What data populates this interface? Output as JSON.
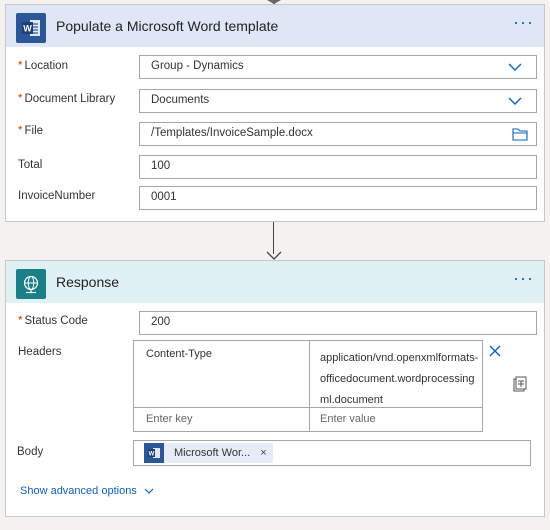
{
  "word_card": {
    "title": "Populate a Microsoft Word template",
    "more_label": "···",
    "accent": "#2b5797",
    "header_bg": "#dfe6f5",
    "fields": [
      {
        "label": "Location",
        "required": true,
        "value": "Group - Dynamics",
        "control": "dropdown"
      },
      {
        "label": "Document Library",
        "required": true,
        "value": "Documents",
        "control": "dropdown"
      },
      {
        "label": "File",
        "required": true,
        "value": "/Templates/InvoiceSample.docx",
        "control": "file-picker"
      },
      {
        "label": "Total",
        "required": false,
        "value": "100",
        "control": "text"
      },
      {
        "label": "InvoiceNumber",
        "required": false,
        "value": "0001",
        "control": "text"
      }
    ]
  },
  "response_card": {
    "title": "Response",
    "more_label": "···",
    "accent": "#1a7f86",
    "header_bg": "#dff1f3",
    "status_code": {
      "label": "Status Code",
      "required": true,
      "value": "200"
    },
    "headers": {
      "label": "Headers",
      "rows": [
        {
          "key": "Content-Type",
          "value": "application/vnd.openxmlformats-officedocument.wordprocessingml.document"
        }
      ],
      "key_placeholder": "Enter key",
      "value_placeholder": "Enter value"
    },
    "body": {
      "label": "Body",
      "token_label": "Microsoft Wor...",
      "token_remove": "×"
    },
    "advanced_options": "Show advanced options"
  },
  "required_marker": "*",
  "link_color": "#0f62b6"
}
